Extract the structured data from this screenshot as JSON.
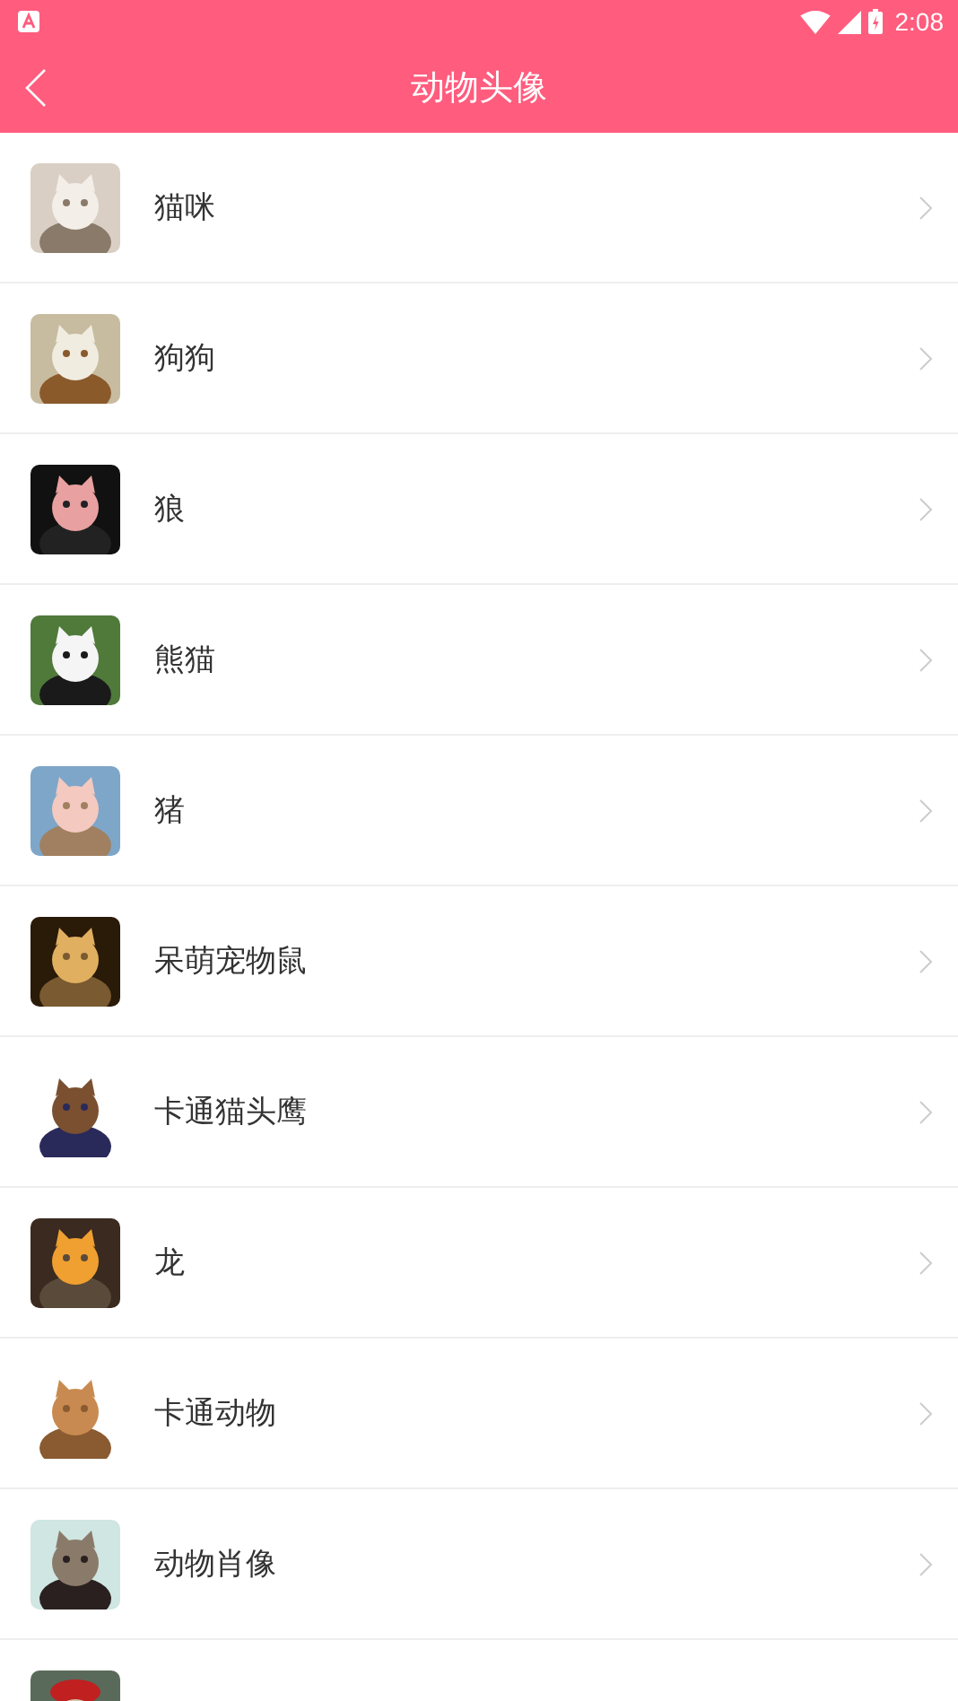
{
  "status_bar": {
    "time": "2:08"
  },
  "toolbar": {
    "title": "动物头像"
  },
  "items": [
    {
      "label": "猫咪"
    },
    {
      "label": "狗狗"
    },
    {
      "label": "狼"
    },
    {
      "label": "熊猫"
    },
    {
      "label": "猪"
    },
    {
      "label": "呆萌宠物鼠"
    },
    {
      "label": "卡通猫头鹰"
    },
    {
      "label": "龙"
    },
    {
      "label": "卡通动物"
    },
    {
      "label": "动物肖像"
    }
  ]
}
